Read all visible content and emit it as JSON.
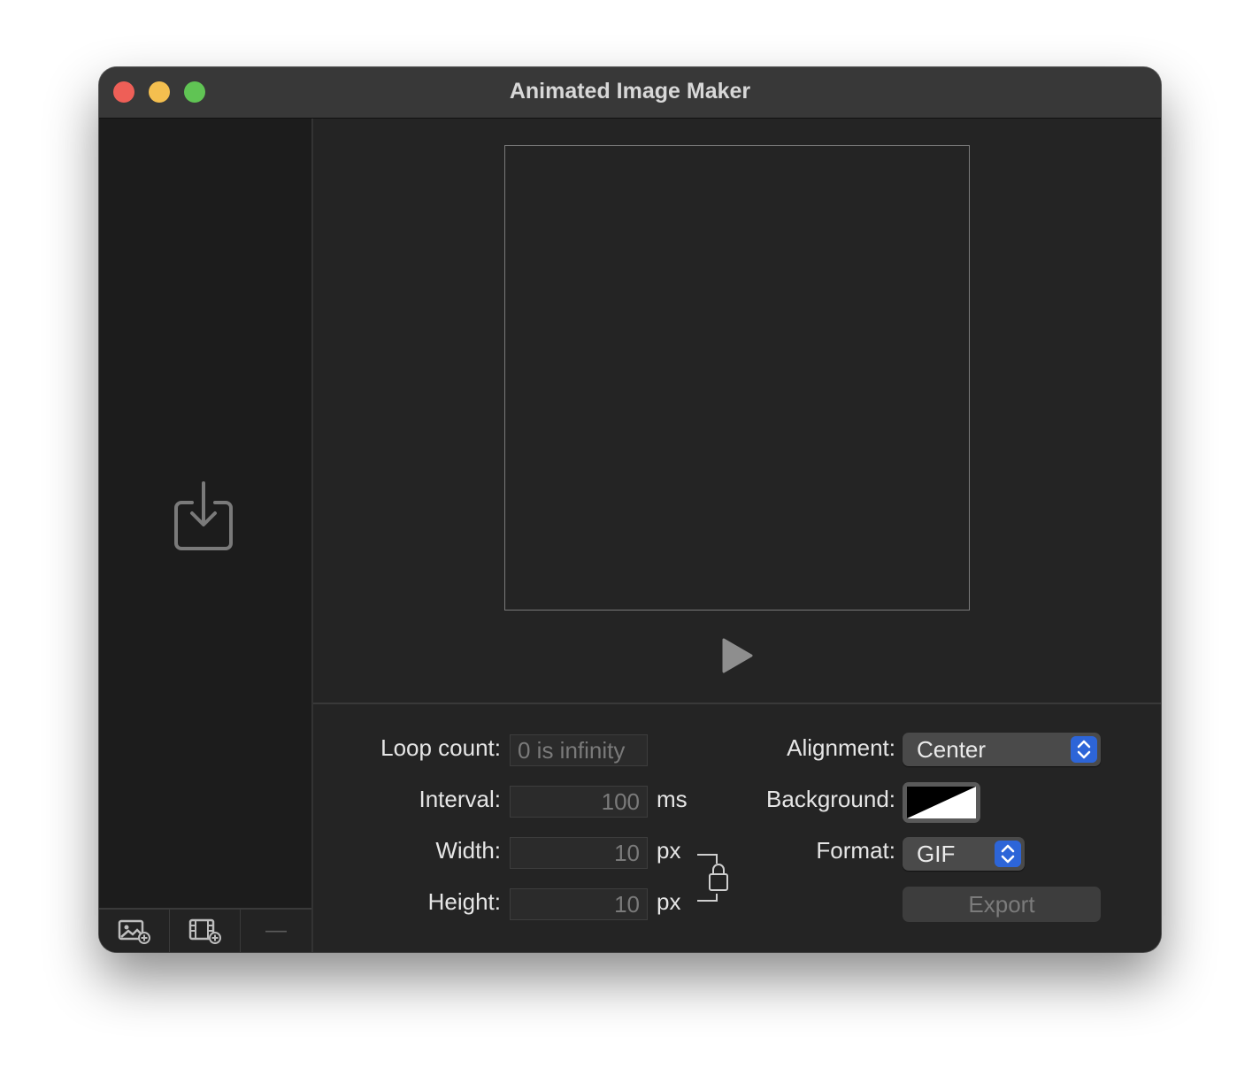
{
  "window": {
    "title": "Animated Image Maker"
  },
  "sidebar": {
    "drop_icon": "import-tray-icon",
    "toolbar": {
      "add_image_icon": "add-image-icon",
      "add_video_icon": "add-video-icon",
      "remove_label": "—"
    }
  },
  "preview": {
    "play_icon": "play-icon"
  },
  "settings": {
    "loop_count": {
      "label": "Loop count:",
      "value": "",
      "placeholder": "0 is infinity"
    },
    "interval": {
      "label": "Interval:",
      "value": "100",
      "unit": "ms"
    },
    "width": {
      "label": "Width:",
      "value": "10",
      "unit": "px"
    },
    "height": {
      "label": "Height:",
      "value": "10",
      "unit": "px"
    },
    "aspect_lock_icon": "lock-icon",
    "alignment": {
      "label": "Alignment:",
      "value": "Center"
    },
    "background": {
      "label": "Background:",
      "color_icon": "color-well-none"
    },
    "format": {
      "label": "Format:",
      "value": "GIF"
    },
    "export_label": "Export"
  },
  "colors": {
    "window_bg": "#242424",
    "sidebar_bg": "#1c1c1c",
    "titlebar_bg": "#383838",
    "accent": "#2d65d8",
    "close": "#ee5f57",
    "minimize": "#f4bf4f",
    "maximize": "#60c454"
  }
}
